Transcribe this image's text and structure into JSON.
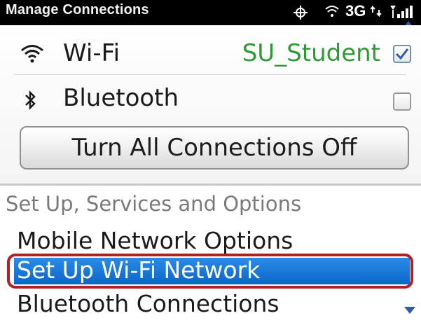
{
  "status_bar": {
    "title": "Manage Connections",
    "network_type": "3G",
    "icons": [
      "gps-icon",
      "wifi-status-icon",
      "network-3g-icon",
      "signal-strength-icon"
    ]
  },
  "connections": {
    "wifi": {
      "label": "Wi-Fi",
      "value": "SU_Student",
      "checked": true,
      "icon": "wifi-icon"
    },
    "bluetooth": {
      "label": "Bluetooth",
      "value": "",
      "checked": false,
      "icon": "bluetooth-icon"
    },
    "toggle_all_label": "Turn All Connections Off"
  },
  "section": {
    "header": "Set Up, Services and Options",
    "items": [
      {
        "label": "Mobile Network Options",
        "selected": false
      },
      {
        "label": "Set Up Wi-Fi Network",
        "selected": true
      },
      {
        "label": "Bluetooth Connections",
        "selected": false
      }
    ]
  },
  "colors": {
    "accent": "#0b65c9",
    "selection_outline": "#b21f24",
    "wifi_value": "#2f9a35"
  }
}
